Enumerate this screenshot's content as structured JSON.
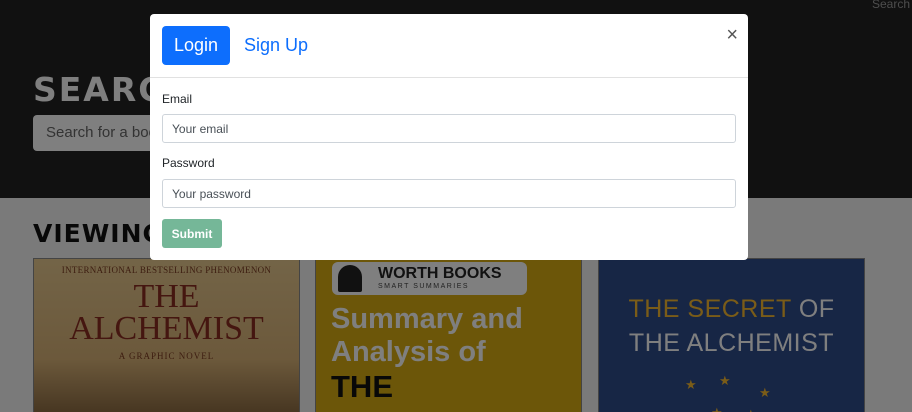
{
  "nav": {
    "search_label": "Search"
  },
  "hero": {
    "title": "SEARCH",
    "search_placeholder": "Search for a book"
  },
  "section": {
    "title": "VIEWING"
  },
  "books": [
    {
      "banner": "INTERNATIONAL BESTSELLING PHENOMENON",
      "title_line1": "THE",
      "title_line2": "ALCHEMIST",
      "subtitle": "A GRAPHIC NOVEL"
    },
    {
      "brand": "WORTH BOOKS",
      "tagline": "SMART SUMMARIES",
      "title_line1": "Summary and",
      "title_line2": "Analysis of",
      "title_line3": "THE"
    },
    {
      "title_accent": "THE SECRET",
      "title_rest": "OF",
      "title_line2": "THE ALCHEMIST"
    }
  ],
  "modal": {
    "tabs": {
      "login": "Login",
      "signup": "Sign Up"
    },
    "close": "×",
    "email_label": "Email",
    "email_placeholder": "Your email",
    "password_label": "Password",
    "password_placeholder": "Your password",
    "submit_label": "Submit"
  },
  "colors": {
    "primary": "#0d6efd",
    "submit": "#75b798",
    "hero_bg": "#222222"
  },
  "icons": {
    "close": "close-icon",
    "star": "star-icon"
  }
}
